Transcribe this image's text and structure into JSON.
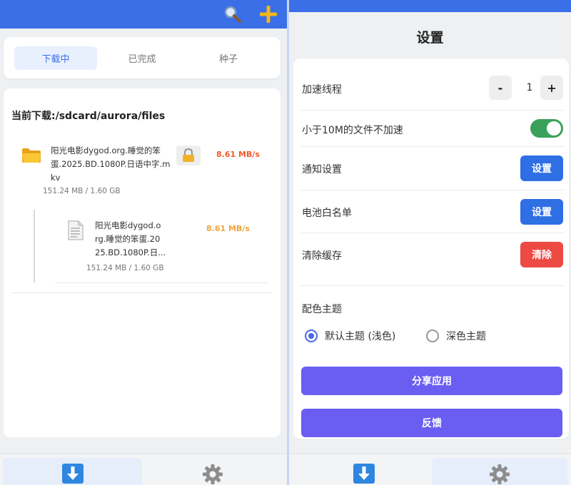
{
  "left": {
    "tabs": [
      {
        "label": "下载中",
        "active": true
      },
      {
        "label": "已完成",
        "active": false
      },
      {
        "label": "种子",
        "active": false
      }
    ],
    "current_path": "当前下载:/sdcard/aurora/files",
    "items": [
      {
        "icon": "folder-icon",
        "name_lines": [
          "阳光电影dygod.org.睡觉的笨",
          "蛋.2025.BD.1080P.日语中字.m",
          "kv"
        ],
        "speed": "8.61 MB/s",
        "size": "151.24 MB / 1.60 GB"
      },
      {
        "icon": "file-icon",
        "name_lines": [
          "阳光电影dygod.o",
          "rg.睡觉的笨蛋.20",
          "25.BD.1080P.日..."
        ],
        "speed": "8.61 MB/s",
        "size": "151.24 MB / 1.60 GB"
      }
    ]
  },
  "right": {
    "title": "设置",
    "threads": {
      "label": "加速线程",
      "minus": "-",
      "value": "1",
      "plus": "+"
    },
    "small_file": {
      "label": "小于10M的文件不加速",
      "enabled": true
    },
    "notify": {
      "label": "通知设置",
      "button": "设置"
    },
    "battery": {
      "label": "电池白名单",
      "button": "设置"
    },
    "cache": {
      "label": "清除缓存",
      "button": "清除"
    },
    "theme": {
      "title": "配色主题",
      "options": [
        {
          "label": "默认主题 (浅色)",
          "selected": true
        },
        {
          "label": "深色主题",
          "selected": false
        }
      ]
    },
    "share_button": "分享应用",
    "feedback_button": "反馈"
  },
  "colors": {
    "primary": "#3b6fe8",
    "speed_active": "#ef5a2f",
    "speed_sub": "#f0a43c",
    "toggle_on": "#3aa15a",
    "danger": "#ec4a43",
    "purple": "#6a5ef2"
  }
}
